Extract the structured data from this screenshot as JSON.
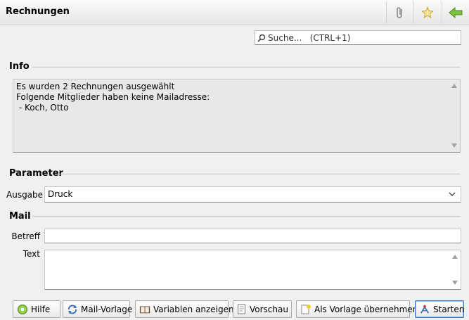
{
  "window": {
    "title": "Rechnungen"
  },
  "toolbar": {
    "icons": [
      "paperclip-icon",
      "star-icon",
      "back-arrow-icon"
    ]
  },
  "search": {
    "placeholder": "Suche...   (CTRL+1)"
  },
  "info": {
    "heading": "Info",
    "lines": [
      "Es wurden 2 Rechnungen ausgewählt",
      "Folgende Mitglieder haben keine Mailadresse:",
      " - Koch, Otto"
    ]
  },
  "parameter": {
    "heading": "Parameter",
    "ausgabe_label": "Ausgabe",
    "ausgabe_value": "Druck"
  },
  "mail": {
    "heading": "Mail",
    "betreff_label": "Betreff",
    "betreff_value": "",
    "text_label": "Text",
    "text_value": ""
  },
  "buttons": {
    "hilfe": "Hilfe",
    "mail_vorlage": "Mail-Vorlage",
    "variablen": "Variablen anzeigen",
    "vorschau": "Vorschau",
    "als_vorlage": "Als Vorlage übernehmen",
    "starten": "Starten"
  },
  "colors": {
    "accent_green": "#6aaa2a",
    "star_yellow": "#f0c419",
    "focus_blue": "#3a7bd5"
  }
}
